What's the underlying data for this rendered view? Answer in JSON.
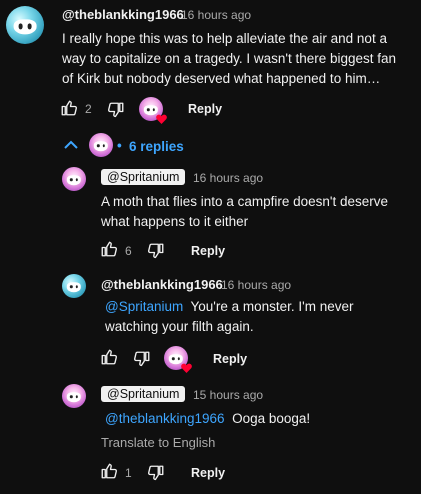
{
  "comment": {
    "author": "@theblankking1966",
    "time": "16 hours ago",
    "text_line1": "I really hope this was to help alleviate the air and not a",
    "text_line2": "way to capitalize on a tragedy. I wasn't there biggest fan",
    "text_line3": "of Kirk but nobody deserved what happened to him…",
    "likes": "2",
    "reply_label": "Reply"
  },
  "replies_toggle": {
    "label": "6 replies"
  },
  "replies": [
    {
      "author": "@Spritanium",
      "time": "16 hours ago",
      "text_line1": "A moth that flies into a campfire doesn't deserve",
      "text_line2": "what happens to it either",
      "likes": "6",
      "reply_label": "Reply"
    },
    {
      "author": "@theblankking1966",
      "time": "16 hours ago",
      "mention": "@Spritanium",
      "text_line1": "You're a monster. I'm never",
      "text_line2": "watching your filth again.",
      "reply_label": "Reply"
    },
    {
      "author": "@Spritanium",
      "time": "15 hours ago",
      "mention": "@theblankking1966",
      "text_line1": "Ooga booga!",
      "translate_label": "Translate to English",
      "likes": "1",
      "reply_label": "Reply"
    }
  ],
  "colors": {
    "background": "#0f0f0f",
    "text": "#f1f1f1",
    "secondary": "#aaaaaa",
    "link": "#3ea6ff",
    "heart": "#ff0033"
  }
}
